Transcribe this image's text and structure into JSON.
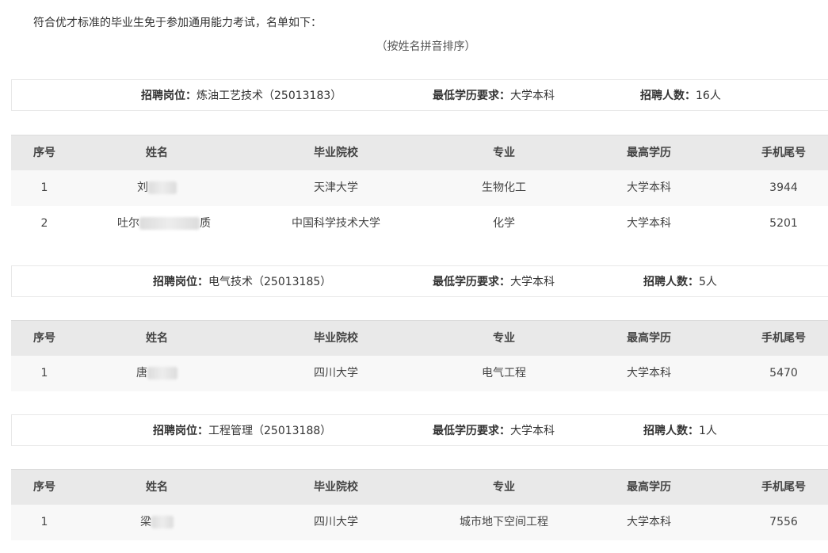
{
  "intro": "符合优才标准的毕业生免于参加通用能力考试，名单如下：",
  "sort_note": "（按姓名拼音排序）",
  "columns": [
    "序号",
    "姓名",
    "毕业院校",
    "专业",
    "最高学历",
    "手机尾号"
  ],
  "posts": [
    {
      "position_label": "招聘岗位：",
      "position_value": "炼油工艺技术（25013183）",
      "edu_label": "最低学历要求：",
      "edu_value": "大学本科",
      "count_label": "招聘人数：",
      "count_value": "16人",
      "rows": [
        {
          "no": "1",
          "name_start": "刘",
          "name_end": "",
          "school": "天津大学",
          "major": "生物化工",
          "degree": "大学本科",
          "phone": "3944"
        },
        {
          "no": "2",
          "name_start": "吐尔",
          "name_end": "质",
          "school": "中国科学技术大学",
          "major": "化学",
          "degree": "大学本科",
          "phone": "5201"
        }
      ]
    },
    {
      "position_label": "招聘岗位：",
      "position_value": "电气技术（25013185）",
      "edu_label": "最低学历要求：",
      "edu_value": "大学本科",
      "count_label": "招聘人数：",
      "count_value": "5人",
      "rows": [
        {
          "no": "1",
          "name_start": "唐",
          "name_end": "",
          "school": "四川大学",
          "major": "电气工程",
          "degree": "大学本科",
          "phone": "5470"
        }
      ]
    },
    {
      "position_label": "招聘岗位：",
      "position_value": "工程管理（25013188）",
      "edu_label": "最低学历要求：",
      "edu_value": "大学本科",
      "count_label": "招聘人数：",
      "count_value": "1人",
      "rows": [
        {
          "no": "1",
          "name_start": "梁",
          "name_end": "",
          "school": "四川大学",
          "major": "城市地下空间工程",
          "degree": "大学本科",
          "phone": "7556"
        }
      ]
    }
  ]
}
